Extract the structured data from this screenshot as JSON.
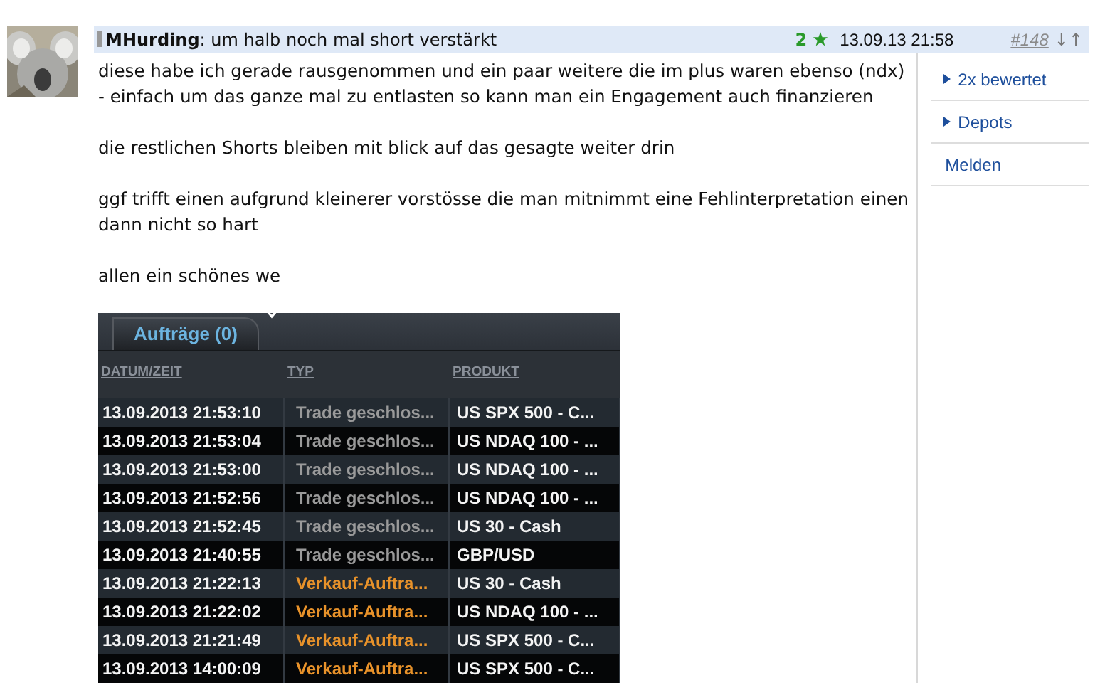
{
  "post": {
    "author": "MHurding",
    "title": ": um halb noch mal short verstärkt",
    "rating": "2",
    "date": "13.09.13 21:58",
    "number": "#148",
    "nav": "↓↑"
  },
  "paragraphs": [
    {
      "lines": [
        "diese habe ich gerade rausgenommen und ein paar weitere die im plus waren ebenso (ndx)",
        "- einfach um das ganze mal zu entlasten so kann man ein Engagement auch finanzieren"
      ]
    },
    {
      "lines": [
        "die restlichen Shorts bleiben mit blick auf das gesagte weiter drin"
      ]
    },
    {
      "lines": [
        "ggf trifft einen aufgrund kleinerer vorstösse die man mitnimmt eine Fehlinterpretation einen",
        "dann nicht so hart"
      ]
    },
    {
      "lines": [
        "allen ein schönes we"
      ]
    }
  ],
  "sidebar": [
    {
      "label": "2x bewertet",
      "kind": "toggle"
    },
    {
      "label": "Depots",
      "kind": "toggle"
    },
    {
      "label": "Melden",
      "kind": "link"
    }
  ],
  "screenshot": {
    "tab": "Aufträge (0)",
    "columns": [
      "DATUM/ZEIT",
      "TYP",
      "PRODUKT"
    ],
    "rows": [
      {
        "date": "13.09.2013 21:53:10",
        "type": "Trade geschlos...",
        "kind": "closed",
        "product": "US SPX 500 - C..."
      },
      {
        "date": "13.09.2013 21:53:04",
        "type": "Trade geschlos...",
        "kind": "closed",
        "product": "US NDAQ 100 - ..."
      },
      {
        "date": "13.09.2013 21:53:00",
        "type": "Trade geschlos...",
        "kind": "closed",
        "product": "US NDAQ 100 - ..."
      },
      {
        "date": "13.09.2013 21:52:56",
        "type": "Trade geschlos...",
        "kind": "closed",
        "product": "US NDAQ 100 - ..."
      },
      {
        "date": "13.09.2013 21:52:45",
        "type": "Trade geschlos...",
        "kind": "closed",
        "product": "US 30 - Cash"
      },
      {
        "date": "13.09.2013 21:40:55",
        "type": "Trade geschlos...",
        "kind": "closed",
        "product": "GBP/USD"
      },
      {
        "date": "13.09.2013 21:22:13",
        "type": "Verkauf-Auftra...",
        "kind": "sell",
        "product": "US 30 - Cash"
      },
      {
        "date": "13.09.2013 21:22:02",
        "type": "Verkauf-Auftra...",
        "kind": "sell",
        "product": "US NDAQ 100 - ..."
      },
      {
        "date": "13.09.2013 21:21:49",
        "type": "Verkauf-Auftra...",
        "kind": "sell",
        "product": "US SPX 500 - C..."
      },
      {
        "date": "13.09.2013 14:00:09",
        "type": "Verkauf-Auftra...",
        "kind": "sell",
        "product": "US SPX 500 - C..."
      }
    ]
  }
}
